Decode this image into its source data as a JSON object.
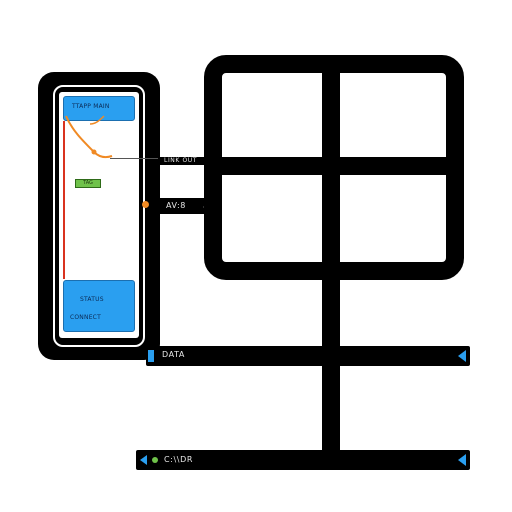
{
  "phone": {
    "header_text": "TTAPP MAIN",
    "tag_text": "TAG",
    "footer_line1": "STATUS",
    "footer_line2": "CONNECT"
  },
  "labels": {
    "connector_top": "LINK OUT",
    "connector_mid": "AV:8"
  },
  "bars": {
    "bar1_text": "DATA",
    "bar2_text": "C:\\\\DR"
  },
  "colors": {
    "accent_blue": "#2a9ff0",
    "accent_orange": "#f08a24",
    "accent_green": "#6fc24a",
    "accent_red": "#d9321f"
  }
}
